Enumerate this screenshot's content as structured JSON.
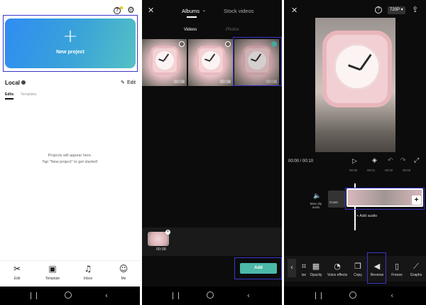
{
  "project_screen": {
    "new_project_label": "New project",
    "local_label": "Local",
    "edit_label": "Edit",
    "tabs": [
      "Edits",
      "Templates"
    ],
    "empty_line1": "Projects will appear here.",
    "empty_line2": "Tap \"New project\" to get started!",
    "bottom_tabs": [
      {
        "label": "Edit",
        "icon": "scissors-icon"
      },
      {
        "label": "Template",
        "icon": "template-icon"
      },
      {
        "label": "Inbox",
        "icon": "bell-icon"
      },
      {
        "label": "Me",
        "icon": "person-icon"
      }
    ],
    "accent_gradient": [
      "#2f8cf2",
      "#55c1c4"
    ]
  },
  "album_screen": {
    "header_tabs": [
      "Albums",
      "Stock videos"
    ],
    "media_tabs": [
      "Videos",
      "Photos"
    ],
    "thumbnails": [
      {
        "duration": "00:08",
        "selected": false
      },
      {
        "duration": "00:08",
        "selected": false
      },
      {
        "duration": "00:08",
        "selected": true
      }
    ],
    "tray_clip_duration": "00:08",
    "add_label": "Add",
    "accent": "#4cb9a8"
  },
  "editor_screen": {
    "resolution": "720P",
    "time_current": "00:00",
    "time_total": "00:10",
    "ruler_ticks": [
      "00:00",
      "00:01",
      "00:02",
      "00:03"
    ],
    "mute_label": "Mute clip audio",
    "cover_label": "Cover",
    "add_audio_label": "+ Add audio",
    "tools": [
      {
        "label": "ize",
        "icon": "resize-icon"
      },
      {
        "label": "Opacity",
        "icon": "opacity-icon"
      },
      {
        "label": "Voice effects",
        "icon": "voice-effects-icon"
      },
      {
        "label": "Copy",
        "icon": "copy-icon"
      },
      {
        "label": "Reverse",
        "icon": "reverse-icon"
      },
      {
        "label": "Freeze",
        "icon": "freeze-icon"
      },
      {
        "label": "Graphs",
        "icon": "graphs-icon"
      }
    ]
  }
}
